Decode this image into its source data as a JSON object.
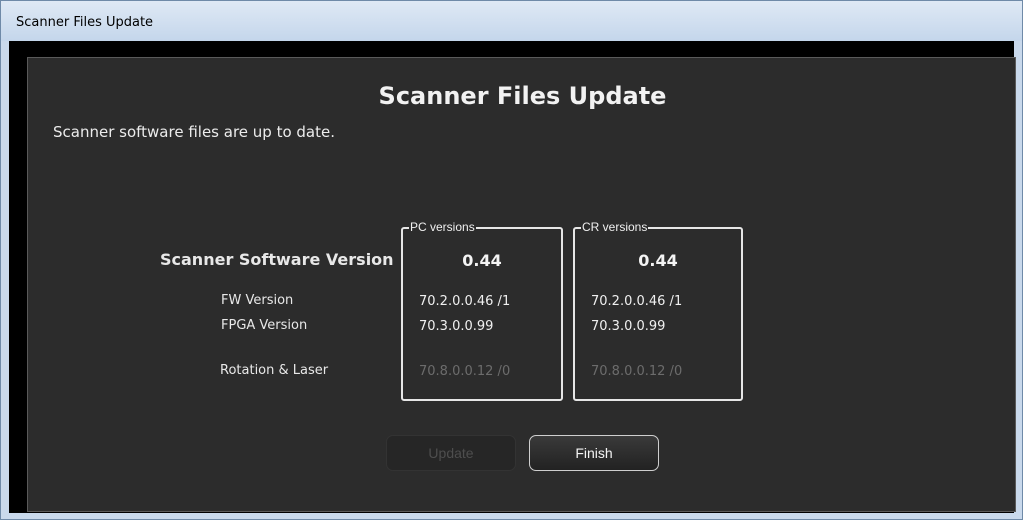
{
  "window": {
    "title": "Scanner Files Update"
  },
  "dialog": {
    "title": "Scanner Files Update",
    "status": "Scanner software files are up to date."
  },
  "rows": {
    "main_label": "Scanner Software Version",
    "fw_label": "FW Version",
    "fpga_label": "FPGA Version",
    "rotation_label": "Rotation & Laser"
  },
  "pc": {
    "legend": "PC versions",
    "main": "0.44",
    "fw": "70.2.0.0.46 /1",
    "fpga": "70.3.0.0.99",
    "rotation": "70.8.0.0.12 /0"
  },
  "cr": {
    "legend": "CR versions",
    "main": "0.44",
    "fw": "70.2.0.0.46 /1",
    "fpga": "70.3.0.0.99",
    "rotation": "70.8.0.0.12 /0"
  },
  "buttons": {
    "update": "Update",
    "finish": "Finish"
  },
  "colors": {
    "dialog_bg": "#2c2c2c",
    "text": "#f0f0f0",
    "dim_text": "#6c6c6c",
    "titlebar": "#c9d9ec"
  }
}
